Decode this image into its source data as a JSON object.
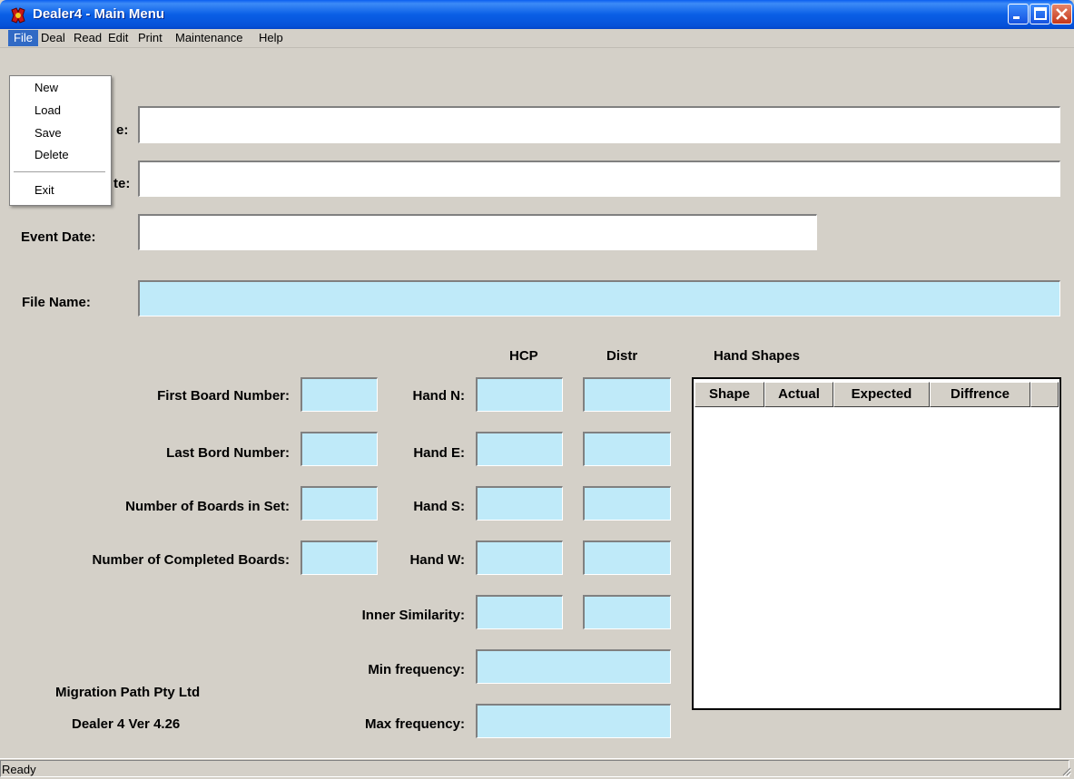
{
  "window": {
    "title": "Dealer4 - Main Menu"
  },
  "menubar": {
    "items": [
      {
        "label": "File",
        "active": true
      },
      {
        "label": "Deal"
      },
      {
        "label": "Read"
      },
      {
        "label": "Edit"
      },
      {
        "label": "Print"
      },
      {
        "label": "Maintenance"
      },
      {
        "label": "Help"
      }
    ]
  },
  "file_menu": {
    "items": [
      {
        "label": "New"
      },
      {
        "label": "Load"
      },
      {
        "label": "Save"
      },
      {
        "label": "Delete"
      },
      {
        "label": "Exit"
      }
    ]
  },
  "form": {
    "name_label_partial": "e:",
    "venue_label_partial": "te:",
    "event_date_label": "Event Date:",
    "file_name_label": "File Name:",
    "first_board_label": "First Board Number:",
    "last_board_label": "Last Bord Number:",
    "boards_in_set_label": "Number of Boards in Set:",
    "completed_boards_label": "Number of Completed Boards:",
    "hcp_header": "HCP",
    "distr_header": "Distr",
    "hand_n_label": "Hand N:",
    "hand_e_label": "Hand E:",
    "hand_s_label": "Hand S:",
    "hand_w_label": "Hand W:",
    "inner_similarity_label": "Inner Similarity:",
    "min_frequency_label": "Min frequency:",
    "max_frequency_label": "Max frequency:"
  },
  "hand_shapes": {
    "title": "Hand Shapes",
    "columns": [
      "Shape",
      "Actual",
      "Expected",
      "Diffrence"
    ],
    "rows": []
  },
  "about": {
    "company": "Migration Path Pty Ltd",
    "version": "Dealer 4 Ver 4.26"
  },
  "status": {
    "text": "Ready"
  },
  "colors": {
    "titlebar": "#0a5fe6",
    "readonly_field": "#bfeaf9",
    "window_bg": "#d4d0c8",
    "menu_highlight": "#316ac5"
  }
}
